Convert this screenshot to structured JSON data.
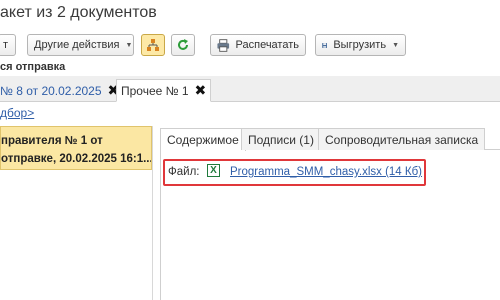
{
  "window": {
    "title": "акет из 2 документов"
  },
  "toolbar": {
    "partial_button_label": "т",
    "other_actions_label": "Другие действия",
    "print_label": "Распечатать",
    "export_label": "Выгрузить"
  },
  "section": {
    "label": "ся отправка"
  },
  "tabs": [
    {
      "label": "№ 8 от 20.02.2025"
    },
    {
      "label": "Прочее № 1"
    }
  ],
  "selection_link": "дбор>",
  "list": {
    "items": [
      {
        "line1": "правителя № 1 от",
        "line2": "отправке, 20.02.2025 16:1..."
      }
    ]
  },
  "detail_tabs": [
    {
      "label": "Содержимое"
    },
    {
      "label": "Подписи (1)"
    },
    {
      "label": "Сопроводительная записка"
    }
  ],
  "file": {
    "label": "Файл:",
    "icon_letter": "X",
    "name": "Programma_SMM_chasy.xlsx (14 Кб)"
  },
  "colors": {
    "accent_highlight": "#fbe7a3",
    "link": "#2f5ea8",
    "focus_border": "#e0373a",
    "excel_green": "#1f7a3c"
  }
}
